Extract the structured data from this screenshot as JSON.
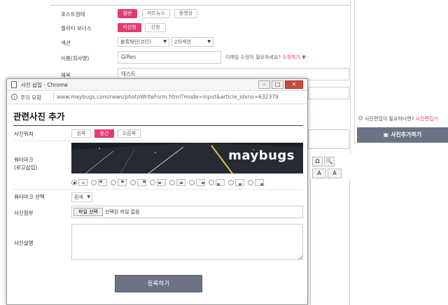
{
  "background_form": {
    "post_type": {
      "label": "포스트형태",
      "options": [
        "일반",
        "카드뉴스",
        "동영상"
      ],
      "selected": "일반"
    },
    "quality_bonus": {
      "label": "퀄리티 보너스",
      "options": [
        "미신청",
        "신청"
      ],
      "selected": "미신청"
    },
    "section": {
      "label": "섹션",
      "select1": "블록체인(코인)",
      "select2": "2차섹션"
    },
    "name": {
      "label": "이름(회사명)",
      "value": "GiRes",
      "hint": "이메일 수정이 필요하세요?",
      "hint_link": "수정하기 ▼"
    },
    "title": {
      "label": "제목",
      "value": "테스트"
    },
    "side_note": {
      "text": "사진편집이 필요하다면?",
      "link": "사진편집기"
    },
    "side_button": "사진추가하기",
    "toolbar": {
      "omega": "Ω",
      "search": "🔍",
      "font_color": "A",
      "bg_color": "A"
    }
  },
  "popup": {
    "window_title": "사진 삽입 - Chrome",
    "secure_label": "주의 요함",
    "url": "www.maybugs.com/news/photoWriteForm.html?mode=input&article_idxno=632379",
    "heading": "관련사진 추가",
    "position": {
      "label": "사진위치",
      "options": [
        "왼쪽",
        "중간",
        "오른쪽"
      ],
      "selected": "중간"
    },
    "watermark": {
      "label_line1": "워터마크",
      "label_line2": "(로고삽입)",
      "brand": "maybugs"
    },
    "watermark_select": {
      "label": "워터마크 선택",
      "value": "흰색"
    },
    "file": {
      "label": "사진첨부",
      "button": "파일 선택",
      "status": "선택된 파일 없음"
    },
    "caption": {
      "label": "사진설명"
    },
    "submit": "등록하기"
  },
  "colors": {
    "accent": "#e33a6e",
    "button": "#6b7384"
  }
}
